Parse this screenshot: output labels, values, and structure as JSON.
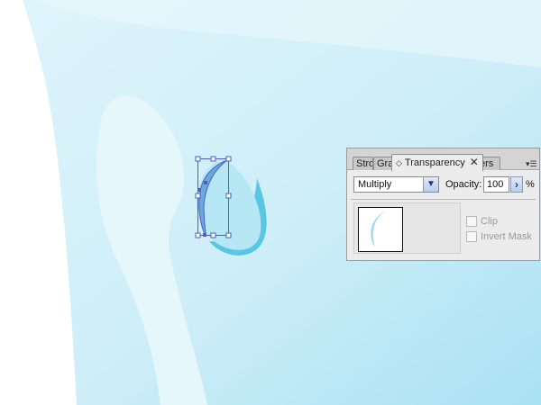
{
  "colors": {
    "sky_light": "#e0f6fc",
    "sky_mid": "#cdeff8",
    "sky_deep": "#aee4f4",
    "cyan_accent": "#59c7e4",
    "selection": "#4b5fc4"
  },
  "panel": {
    "tabs": [
      "Stro",
      "Gra",
      "Transparency",
      "ers"
    ],
    "active_tab": "Transparency",
    "diamond_glyph": "◇",
    "close_glyph": "✕",
    "menu_glyph": "▾☰",
    "blend_mode": "Multiply",
    "opacity_label": "Opacity:",
    "opacity_value": "100",
    "opacity_unit": "%",
    "clip_label": "Clip",
    "invert_mask_label": "Invert Mask"
  }
}
